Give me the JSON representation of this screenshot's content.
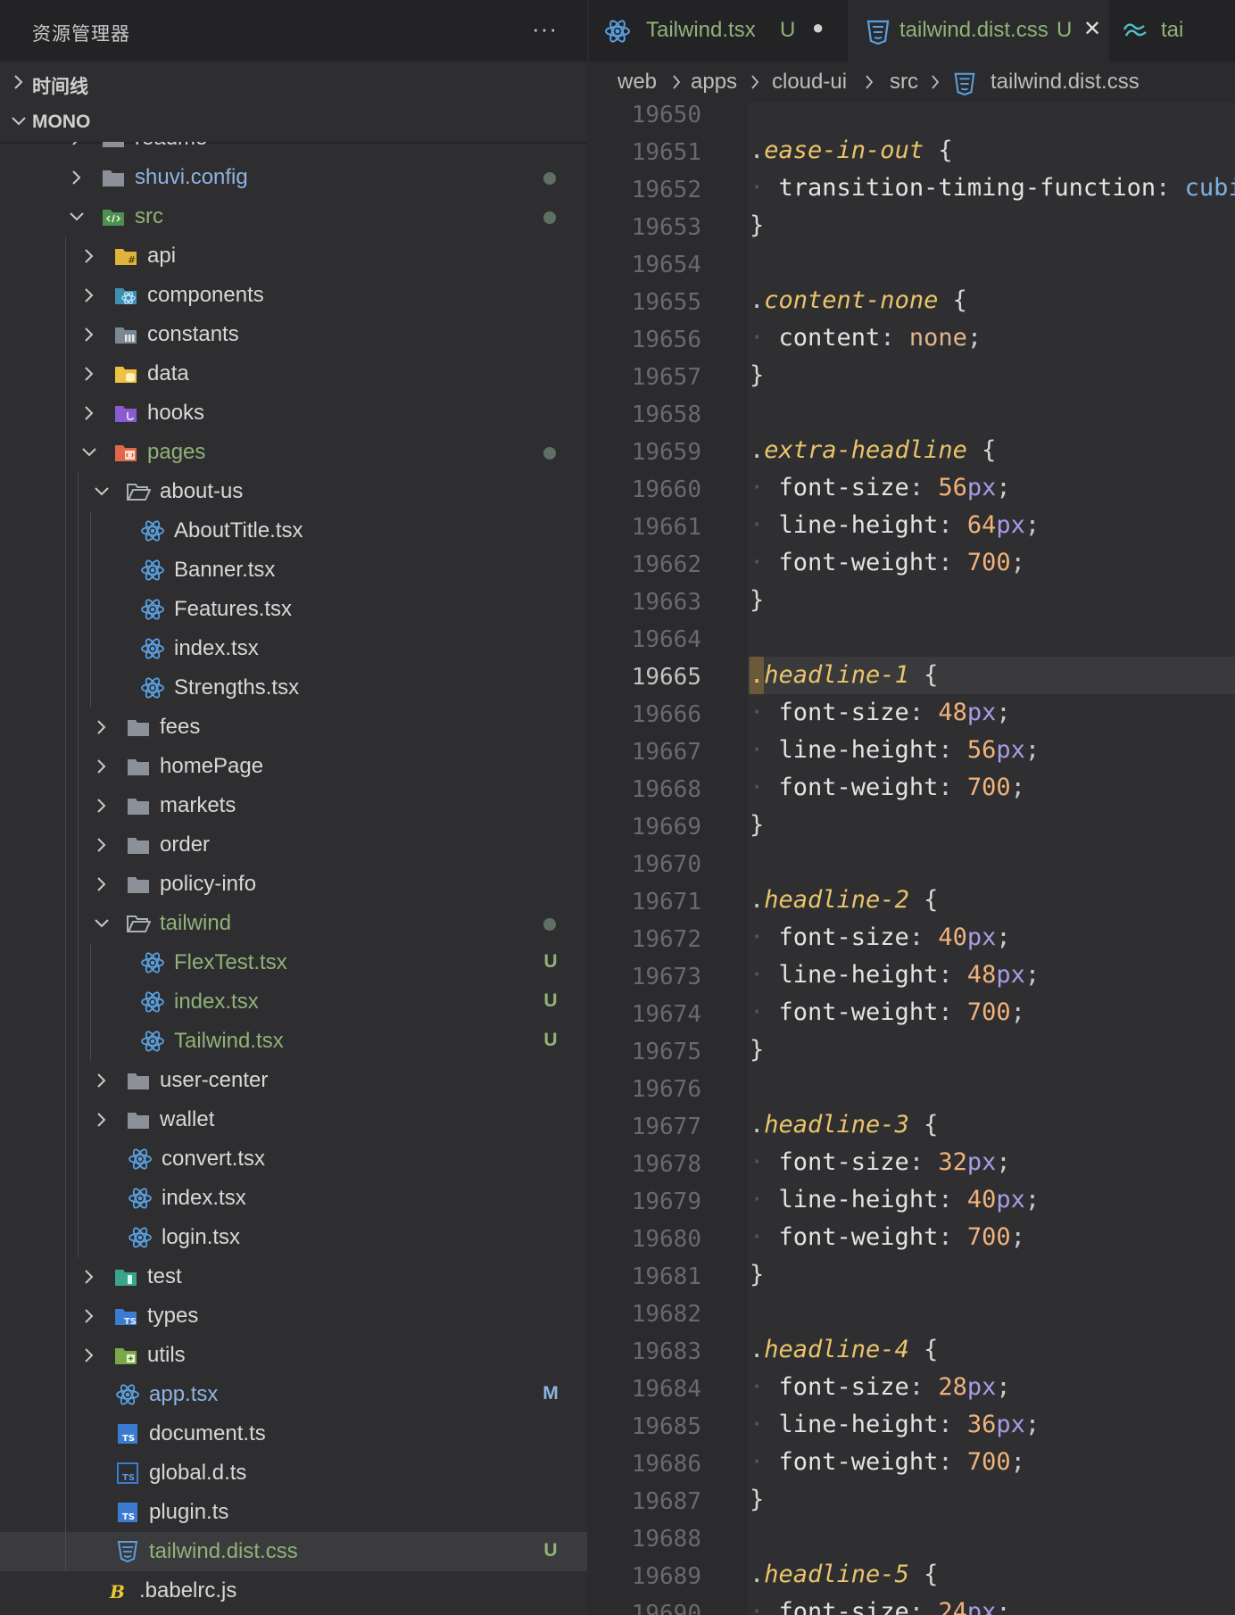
{
  "sidebar": {
    "title": "资源管理器",
    "more": "···",
    "sections": [
      {
        "label": "时间线",
        "expanded": false
      },
      {
        "label": "MONO",
        "expanded": true
      }
    ],
    "tree": [
      {
        "label": "readme",
        "depth": 0,
        "type": "folder",
        "expanded": false,
        "icon": "folder-icon"
      },
      {
        "label": "shuvi.config",
        "depth": 0,
        "type": "folder",
        "expanded": false,
        "icon": "folder-icon",
        "color": "blue",
        "dot": true
      },
      {
        "label": "src",
        "depth": 0,
        "type": "folder",
        "expanded": true,
        "icon": "src-folder-icon",
        "color": "green",
        "dot": true
      },
      {
        "label": "api",
        "depth": 1,
        "type": "folder",
        "expanded": false,
        "icon": "api-folder-icon"
      },
      {
        "label": "components",
        "depth": 1,
        "type": "folder",
        "expanded": false,
        "icon": "components-folder-icon"
      },
      {
        "label": "constants",
        "depth": 1,
        "type": "folder",
        "expanded": false,
        "icon": "constants-folder-icon"
      },
      {
        "label": "data",
        "depth": 1,
        "type": "folder",
        "expanded": false,
        "icon": "data-folder-icon"
      },
      {
        "label": "hooks",
        "depth": 1,
        "type": "folder",
        "expanded": false,
        "icon": "hooks-folder-icon"
      },
      {
        "label": "pages",
        "depth": 1,
        "type": "folder",
        "expanded": true,
        "icon": "pages-folder-icon",
        "color": "green",
        "dot": true
      },
      {
        "label": "about-us",
        "depth": 2,
        "type": "folder",
        "expanded": true,
        "icon": "folder-open-icon"
      },
      {
        "label": "AboutTitle.tsx",
        "depth": 3,
        "type": "file",
        "icon": "react-icon"
      },
      {
        "label": "Banner.tsx",
        "depth": 3,
        "type": "file",
        "icon": "react-icon"
      },
      {
        "label": "Features.tsx",
        "depth": 3,
        "type": "file",
        "icon": "react-icon"
      },
      {
        "label": "index.tsx",
        "depth": 3,
        "type": "file",
        "icon": "react-icon"
      },
      {
        "label": "Strengths.tsx",
        "depth": 3,
        "type": "file",
        "icon": "react-icon"
      },
      {
        "label": "fees",
        "depth": 2,
        "type": "folder",
        "expanded": false,
        "icon": "folder-icon"
      },
      {
        "label": "homePage",
        "depth": 2,
        "type": "folder",
        "expanded": false,
        "icon": "folder-icon"
      },
      {
        "label": "markets",
        "depth": 2,
        "type": "folder",
        "expanded": false,
        "icon": "folder-icon"
      },
      {
        "label": "order",
        "depth": 2,
        "type": "folder",
        "expanded": false,
        "icon": "folder-icon"
      },
      {
        "label": "policy-info",
        "depth": 2,
        "type": "folder",
        "expanded": false,
        "icon": "folder-icon"
      },
      {
        "label": "tailwind",
        "depth": 2,
        "type": "folder",
        "expanded": true,
        "icon": "folder-open-icon",
        "color": "green",
        "dot": true
      },
      {
        "label": "FlexTest.tsx",
        "depth": 3,
        "type": "file",
        "icon": "react-icon",
        "color": "green",
        "badge": "U"
      },
      {
        "label": "index.tsx",
        "depth": 3,
        "type": "file",
        "icon": "react-icon",
        "color": "green",
        "badge": "U"
      },
      {
        "label": "Tailwind.tsx",
        "depth": 3,
        "type": "file",
        "icon": "react-icon",
        "color": "green",
        "badge": "U"
      },
      {
        "label": "user-center",
        "depth": 2,
        "type": "folder",
        "expanded": false,
        "icon": "folder-icon"
      },
      {
        "label": "wallet",
        "depth": 2,
        "type": "folder",
        "expanded": false,
        "icon": "folder-icon"
      },
      {
        "label": "convert.tsx",
        "depth": 2,
        "type": "file",
        "icon": "react-icon"
      },
      {
        "label": "index.tsx",
        "depth": 2,
        "type": "file",
        "icon": "react-icon"
      },
      {
        "label": "login.tsx",
        "depth": 2,
        "type": "file",
        "icon": "react-icon"
      },
      {
        "label": "test",
        "depth": 1,
        "type": "folder",
        "expanded": false,
        "icon": "test-folder-icon"
      },
      {
        "label": "types",
        "depth": 1,
        "type": "folder",
        "expanded": false,
        "icon": "types-folder-icon"
      },
      {
        "label": "utils",
        "depth": 1,
        "type": "folder",
        "expanded": false,
        "icon": "utils-folder-icon"
      },
      {
        "label": "app.tsx",
        "depth": 1,
        "type": "file",
        "icon": "react-icon",
        "color": "blue",
        "badge": "M"
      },
      {
        "label": "document.ts",
        "depth": 1,
        "type": "file",
        "icon": "typescript-icon"
      },
      {
        "label": "global.d.ts",
        "depth": 1,
        "type": "file",
        "icon": "typescript-def-icon"
      },
      {
        "label": "plugin.ts",
        "depth": 1,
        "type": "file",
        "icon": "typescript-icon"
      },
      {
        "label": "tailwind.dist.css",
        "depth": 1,
        "type": "file",
        "icon": "css-icon",
        "color": "green",
        "badge": "U",
        "selected": true
      },
      {
        "label": ".babelrc.js",
        "depth": 0,
        "type": "file",
        "icon": "babel-icon"
      }
    ]
  },
  "tabs": [
    {
      "label": "Tailwind.tsx",
      "status": "U",
      "icon": "react-icon",
      "modified": true,
      "active": false,
      "indicator": "●"
    },
    {
      "label": "tailwind.dist.css",
      "status": "U",
      "icon": "css-icon",
      "modified": false,
      "active": true,
      "indicator": "✕"
    },
    {
      "label": "tai",
      "status": "",
      "icon": "tailwind-icon",
      "modified": false,
      "active": false
    }
  ],
  "breadcrumb": [
    "web",
    "apps",
    "cloud-ui",
    "src",
    "tailwind.dist.css"
  ],
  "editor": {
    "active_line": 19665,
    "lines": [
      {
        "n": 19650,
        "code": ""
      },
      {
        "n": 19651,
        "sel": "ease-in-out"
      },
      {
        "n": 19652,
        "prop": "transition-timing-function",
        "fn": "cubic"
      },
      {
        "n": 19653,
        "close": true
      },
      {
        "n": 19654,
        "code": ""
      },
      {
        "n": 19655,
        "sel": "content-none"
      },
      {
        "n": 19656,
        "prop": "content",
        "val": "none"
      },
      {
        "n": 19657,
        "close": true
      },
      {
        "n": 19658,
        "code": ""
      },
      {
        "n": 19659,
        "sel": "extra-headline"
      },
      {
        "n": 19660,
        "prop": "font-size",
        "num": "56",
        "unit": "px"
      },
      {
        "n": 19661,
        "prop": "line-height",
        "num": "64",
        "unit": "px"
      },
      {
        "n": 19662,
        "prop": "font-weight",
        "num": "700"
      },
      {
        "n": 19663,
        "close": true
      },
      {
        "n": 19664,
        "code": ""
      },
      {
        "n": 19665,
        "sel": "headline-1",
        "cursor": true
      },
      {
        "n": 19666,
        "prop": "font-size",
        "num": "48",
        "unit": "px"
      },
      {
        "n": 19667,
        "prop": "line-height",
        "num": "56",
        "unit": "px"
      },
      {
        "n": 19668,
        "prop": "font-weight",
        "num": "700"
      },
      {
        "n": 19669,
        "close": true
      },
      {
        "n": 19670,
        "code": ""
      },
      {
        "n": 19671,
        "sel": "headline-2"
      },
      {
        "n": 19672,
        "prop": "font-size",
        "num": "40",
        "unit": "px"
      },
      {
        "n": 19673,
        "prop": "line-height",
        "num": "48",
        "unit": "px"
      },
      {
        "n": 19674,
        "prop": "font-weight",
        "num": "700"
      },
      {
        "n": 19675,
        "close": true
      },
      {
        "n": 19676,
        "code": ""
      },
      {
        "n": 19677,
        "sel": "headline-3"
      },
      {
        "n": 19678,
        "prop": "font-size",
        "num": "32",
        "unit": "px"
      },
      {
        "n": 19679,
        "prop": "line-height",
        "num": "40",
        "unit": "px"
      },
      {
        "n": 19680,
        "prop": "font-weight",
        "num": "700"
      },
      {
        "n": 19681,
        "close": true
      },
      {
        "n": 19682,
        "code": ""
      },
      {
        "n": 19683,
        "sel": "headline-4"
      },
      {
        "n": 19684,
        "prop": "font-size",
        "num": "28",
        "unit": "px"
      },
      {
        "n": 19685,
        "prop": "line-height",
        "num": "36",
        "unit": "px"
      },
      {
        "n": 19686,
        "prop": "font-weight",
        "num": "700"
      },
      {
        "n": 19687,
        "close": true
      },
      {
        "n": 19688,
        "code": ""
      },
      {
        "n": 19689,
        "sel": "headline-5"
      },
      {
        "n": 19690,
        "prop": "font-size",
        "num": "24",
        "unit": "px"
      }
    ]
  },
  "colors": {
    "sidebar_bg": "#2e2e30",
    "header_bg": "#232326",
    "editor_bg": "#2f2f31",
    "selector": "#e9c46a",
    "number": "#f0b27a",
    "unit": "#a99be6",
    "git_untracked": "#8fb377",
    "git_modified": "#8fb3e0"
  }
}
